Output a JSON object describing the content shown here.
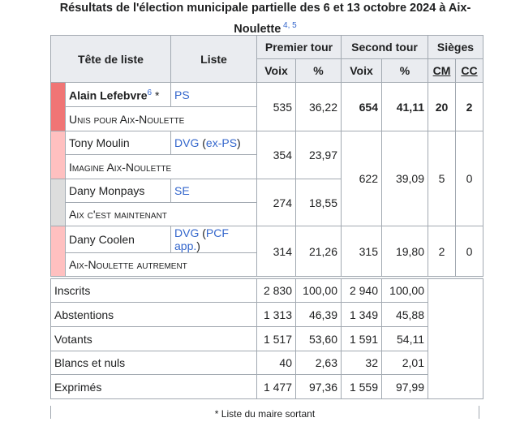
{
  "caption": {
    "title": "Résultats de l'élection municipale partielle des 6 et 13 octobre 2024 à Aix-Noulette",
    "refs": "4, 5"
  },
  "headers": {
    "head_of_list": "Tête de liste",
    "list": "Liste",
    "first_round": "Premier tour",
    "second_round": "Second tour",
    "seats": "Sièges",
    "votes": "Voix",
    "percent": "%",
    "cm": "CM",
    "cc": "CC"
  },
  "colors": {
    "ps": "#f07575",
    "dvg": "#ffc0c0",
    "se": "#dddddd",
    "dvg2": "#ffc0c0"
  },
  "rows": [
    {
      "head": "Alain Lefebvre",
      "ref": "6",
      "mark": "*",
      "party": "PS",
      "list_name": "Unis pour Aix-Noulette",
      "votes1": "535",
      "pct1": "36,22",
      "votes2": "654",
      "pct2": "41,11",
      "cm": "20",
      "cc": "2"
    },
    {
      "head": "Tony Moulin",
      "party": "DVG",
      "party_note": "ex-PS",
      "list_name": "Imagine Aix-Noulette",
      "votes1": "354",
      "pct1": "23,97"
    },
    {
      "head": "Dany Monpays",
      "party": "SE",
      "list_name": "Aix c'est maintenant",
      "votes1": "274",
      "pct1": "18,55"
    },
    {
      "head": "Dany Coolen",
      "party": "DVG",
      "party_note": "PCF app.",
      "list_name": "Aix-Noulette autrement",
      "votes1": "314",
      "pct1": "21,26",
      "votes2": "315",
      "pct2": "19,80",
      "cm": "2",
      "cc": "0"
    }
  ],
  "merged": {
    "votes2": "622",
    "pct2": "39,09",
    "cm": "5",
    "cc": "0"
  },
  "stats": [
    {
      "label": "Inscrits",
      "v1": "2 830",
      "p1": "100,00",
      "v2": "2 940",
      "p2": "100,00"
    },
    {
      "label": "Abstentions",
      "v1": "1 313",
      "p1": "46,39",
      "v2": "1 349",
      "p2": "45,88"
    },
    {
      "label": "Votants",
      "v1": "1 517",
      "p1": "53,60",
      "v2": "1 591",
      "p2": "54,11"
    },
    {
      "label": "Blancs et nuls",
      "v1": "40",
      "p1": "2,63",
      "v2": "32",
      "p2": "2,01"
    },
    {
      "label": "Exprimés",
      "v1": "1 477",
      "p1": "97,36",
      "v2": "1 559",
      "p2": "97,99"
    }
  ],
  "footnote": "* Liste du maire sortant"
}
